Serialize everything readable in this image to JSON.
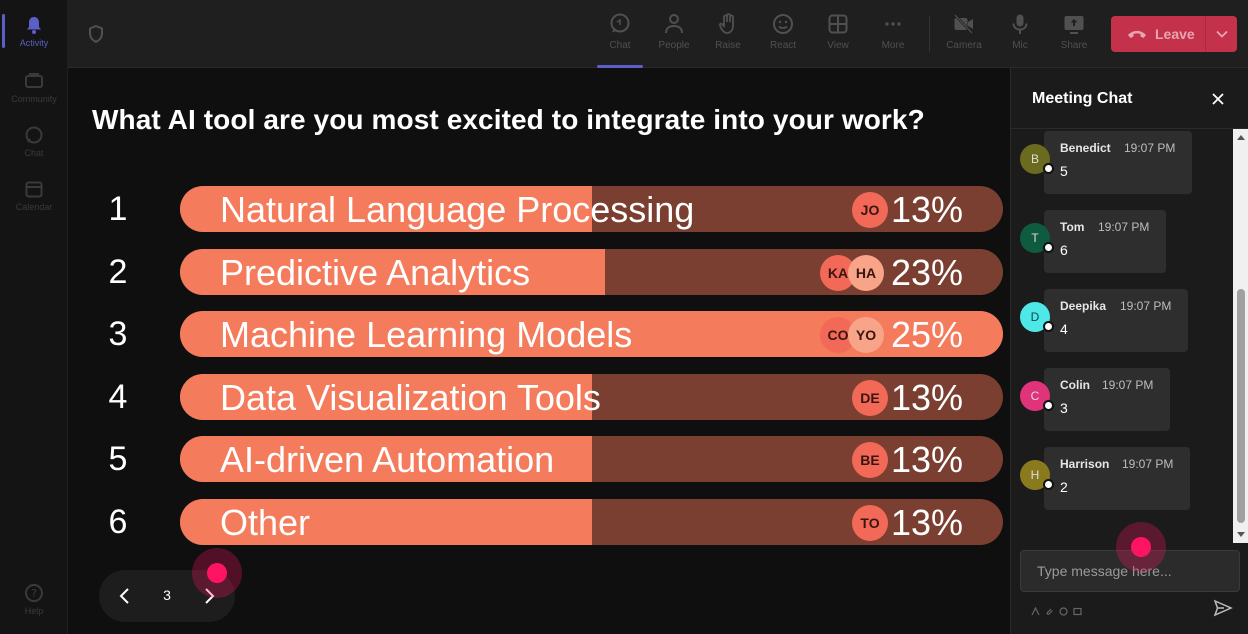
{
  "rail": {
    "items": [
      {
        "label": "Activity",
        "icon": "bell-icon"
      },
      {
        "label": "Community",
        "icon": "community-icon"
      },
      {
        "label": "Chat",
        "icon": "chat-icon"
      },
      {
        "label": "Calendar",
        "icon": "calendar-icon"
      },
      {
        "label": "Help",
        "icon": "help-icon"
      }
    ]
  },
  "toolbar": {
    "chat": "Chat",
    "people": "People",
    "raise": "Raise",
    "react": "React",
    "view": "View",
    "more": "More",
    "camera": "Camera",
    "mic": "Mic",
    "share": "Share",
    "leave": "Leave"
  },
  "poll": {
    "question": "What AI tool are you most excited to integrate into your work?",
    "options": [
      {
        "num": "1",
        "label": "Natural Language Processing",
        "pct": "13%",
        "fill": 0.13,
        "avatars": [
          "JO"
        ]
      },
      {
        "num": "2",
        "label": "Predictive Analytics",
        "pct": "23%",
        "fill": 0.23,
        "avatars": [
          "KA",
          "HA"
        ]
      },
      {
        "num": "3",
        "label": "Machine Learning Models",
        "pct": "25%",
        "fill": 0.25,
        "avatars": [
          "CO",
          "YO"
        ]
      },
      {
        "num": "4",
        "label": "Data Visualization Tools",
        "pct": "13%",
        "fill": 0.13,
        "avatars": [
          "DE"
        ]
      },
      {
        "num": "5",
        "label": "AI-driven Automation",
        "pct": "13%",
        "fill": 0.13,
        "avatars": [
          "BE"
        ]
      },
      {
        "num": "6",
        "label": "Other",
        "pct": "13%",
        "fill": 0.13,
        "avatars": [
          "TO"
        ]
      }
    ],
    "page": "3"
  },
  "chat": {
    "title": "Meeting Chat",
    "messages": [
      {
        "initial": "B",
        "name": "Benedict",
        "time": "19:07 PM",
        "text": "5",
        "color": "#6b6b1f"
      },
      {
        "initial": "T",
        "name": "Tom",
        "time": "19:07 PM",
        "text": "6",
        "color": "#0e5b3f"
      },
      {
        "initial": "D",
        "name": "Deepika",
        "time": "19:07 PM",
        "text": "4",
        "color": "#4ee8e8"
      },
      {
        "initial": "C",
        "name": "Colin",
        "time": "19:07 PM",
        "text": "3",
        "color": "#e0337a"
      },
      {
        "initial": "H",
        "name": "Harrison",
        "time": "19:07 PM",
        "text": "2",
        "color": "#8a7a1e"
      }
    ],
    "placeholder": "Type message here..."
  },
  "colors": {
    "accent": "#5b5fc7",
    "leave": "#c4314b",
    "bar_fill": "#f47c5c",
    "bar_track": "#7a3f31"
  }
}
